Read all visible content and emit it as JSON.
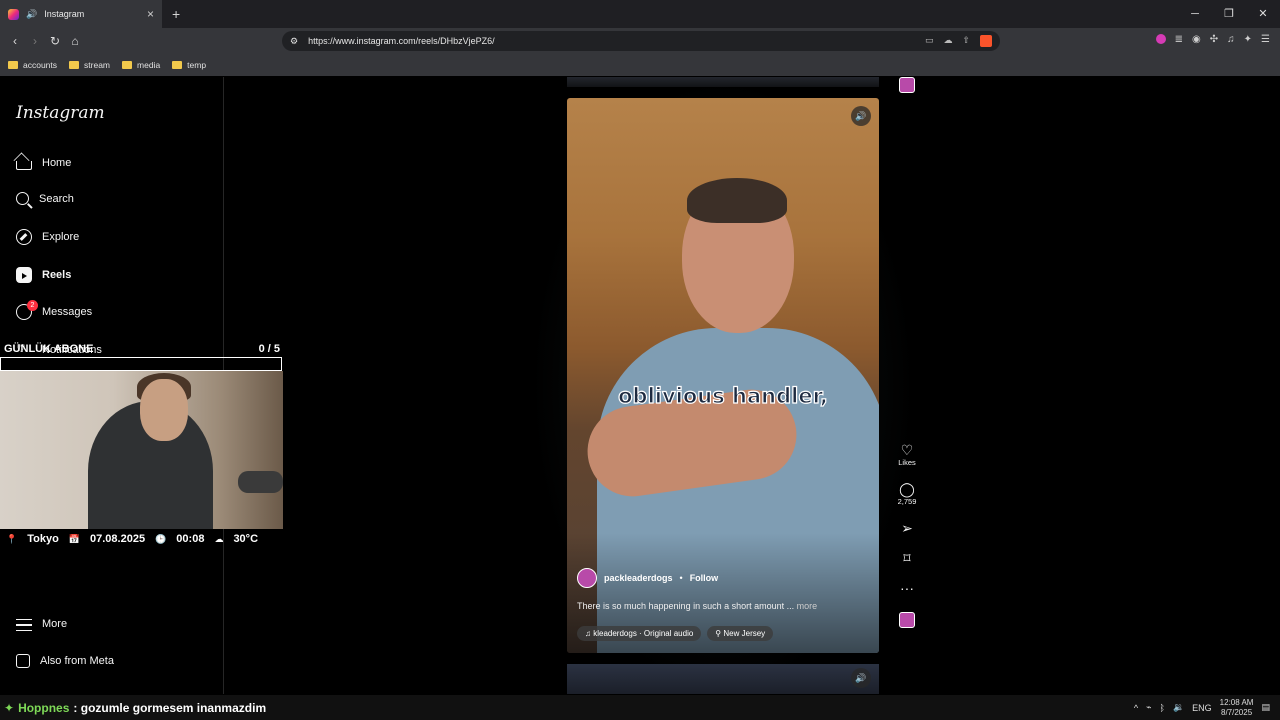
{
  "browser": {
    "tab_title": "Instagram",
    "tab_close": "×",
    "new_tab": "+",
    "url": "https://www.instagram.com/reels/DHbzVjePZ6/",
    "window_controls": [
      "─",
      "❐",
      "✕"
    ],
    "bookmarks": [
      "accounts",
      "stream",
      "media",
      "temp"
    ]
  },
  "sidebar": {
    "logo": "Instagram",
    "items": [
      {
        "label": "Home",
        "icon": "home-icon"
      },
      {
        "label": "Search",
        "icon": "search-icon"
      },
      {
        "label": "Explore",
        "icon": "compass-icon"
      },
      {
        "label": "Reels",
        "icon": "reels-icon"
      },
      {
        "label": "Messages",
        "icon": "messenger-icon"
      },
      {
        "label": "Notifications",
        "icon": "heart-icon"
      }
    ],
    "messages_badge": "2",
    "more": "More",
    "meta": "Also from Meta"
  },
  "overlay": {
    "title": "GÜNLÜK ABONE",
    "counter": "0 / 5",
    "city": "Tokyo",
    "date": "07.08.2025",
    "time": "00:08",
    "temp": "30°C"
  },
  "reel": {
    "caption_overlay": "oblivious handler,",
    "author": "packleaderdogs",
    "follow": "Follow",
    "description": "There is so much happening in such a short amount ...",
    "more": "more",
    "audio": "kleaderdogs · Original audio",
    "location": "New Jersey",
    "likes_label": "Likes",
    "comments_count": "2,759"
  },
  "taskbar": {
    "stream_user": "Hoppnes",
    "stream_message": ": gozumle gormesem inanmazdim",
    "lang": "ENG",
    "time": "12:08 AM",
    "date": "8/7/2025"
  }
}
